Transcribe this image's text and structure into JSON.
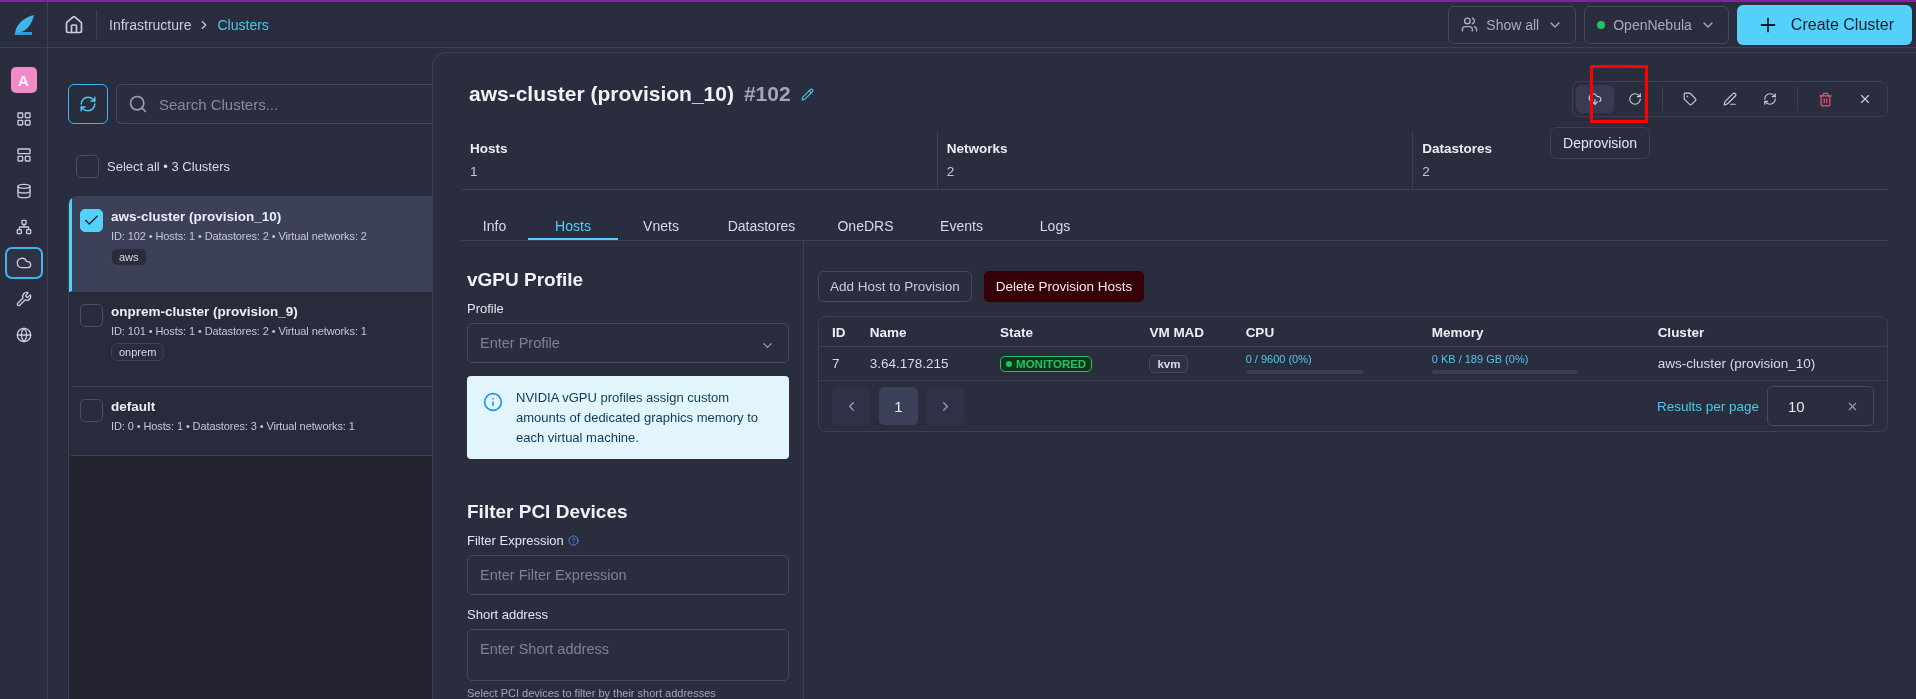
{
  "topbar": {
    "breadcrumb": [
      {
        "label": "Infrastructure",
        "current": false
      },
      {
        "label": "Clusters",
        "current": true
      }
    ],
    "filter": "Show all",
    "zone": {
      "label": "OpenNebula",
      "online": true
    },
    "create_button": "Create Cluster"
  },
  "rail": {
    "avatar": "A",
    "items": [
      {
        "selected": false
      },
      {
        "selected": false
      },
      {
        "selected": false
      },
      {
        "selected": false
      },
      {
        "selected": true
      },
      {
        "selected": false
      },
      {
        "selected": false
      }
    ]
  },
  "list": {
    "search_placeholder": "Search Clusters...",
    "select_all": {
      "label": "Select all • 3 Clusters",
      "checked": false
    },
    "clusters": [
      {
        "name": "aws-cluster (provision_10)",
        "meta": "ID: 102 • Hosts: 1 • Datastores: 2 • Virtual networks: 2",
        "tag": "aws",
        "selected": true,
        "checked": true
      },
      {
        "name": "onprem-cluster (provision_9)",
        "meta": "ID: 101 • Hosts: 1 • Datastores: 2 • Virtual networks: 1",
        "tag": "onprem",
        "selected": false,
        "checked": false
      },
      {
        "name": "default",
        "meta": "ID: 0 • Hosts: 1 • Datastores: 3 • Virtual networks: 1",
        "selected": false,
        "checked": false
      }
    ]
  },
  "detail": {
    "title": "aws-cluster (provision_10)",
    "id": "#102",
    "tooltip": "Deprovision",
    "action_groups": [
      {
        "actions": [
          {
            "kind": "normal",
            "selected": true
          },
          {
            "kind": "normal",
            "selected": false
          }
        ]
      },
      {
        "actions": [
          {
            "kind": "normal",
            "selected": false
          },
          {
            "kind": "normal",
            "selected": false
          },
          {
            "kind": "normal",
            "selected": false
          }
        ]
      },
      {
        "actions": [
          {
            "kind": "danger",
            "selected": false
          },
          {
            "kind": "normal",
            "selected": false
          }
        ]
      }
    ],
    "stats": [
      {
        "label": "Hosts",
        "value": "1"
      },
      {
        "label": "Networks",
        "value": "2"
      },
      {
        "label": "Datastores",
        "value": "2"
      }
    ],
    "tabs": [
      {
        "label": "Info",
        "selected": false
      },
      {
        "label": "Hosts",
        "selected": true
      },
      {
        "label": "Vnets",
        "selected": false
      },
      {
        "label": "Datastores",
        "selected": false
      },
      {
        "label": "OneDRS",
        "selected": false
      },
      {
        "label": "Events",
        "selected": false
      },
      {
        "label": "Logs",
        "selected": false
      }
    ],
    "vgpu": {
      "heading": "vGPU Profile",
      "profile_label": "Profile",
      "profile_placeholder": "Enter Profile",
      "info": "NVIDIA vGPU profiles assign custom amounts of dedicated graphics memory to each virtual machine."
    },
    "pci": {
      "heading": "Filter PCI Devices",
      "filter_label": "Filter Expression",
      "filter_placeholder": "Enter Filter Expression",
      "short_label": "Short address",
      "short_placeholder": "Enter Short address",
      "hint": "Select PCI devices to filter by their short addresses"
    },
    "host_actions": [
      {
        "label": "Add Host to Provision",
        "kind": "secondary"
      },
      {
        "label": "Delete Provision Hosts",
        "kind": "danger"
      }
    ],
    "table": {
      "columns": [
        "ID",
        "Name",
        "State",
        "VM MAD",
        "CPU",
        "Memory",
        "Cluster"
      ],
      "rows": [
        {
          "id": "7",
          "name": "3.64.178.215",
          "state": "MONITORED",
          "vm_mad": "kvm",
          "cpu": {
            "text": "0 / 9600 (0%)",
            "level": 0
          },
          "memory": {
            "text": "0 KB / 189 GB (0%)",
            "level": 0
          },
          "cluster": "aws-cluster (provision_10)"
        }
      ]
    },
    "pagination": {
      "pages": [
        {
          "label": "1",
          "selected": true
        }
      ],
      "results_label": "Results per page",
      "per_page": "10"
    }
  }
}
